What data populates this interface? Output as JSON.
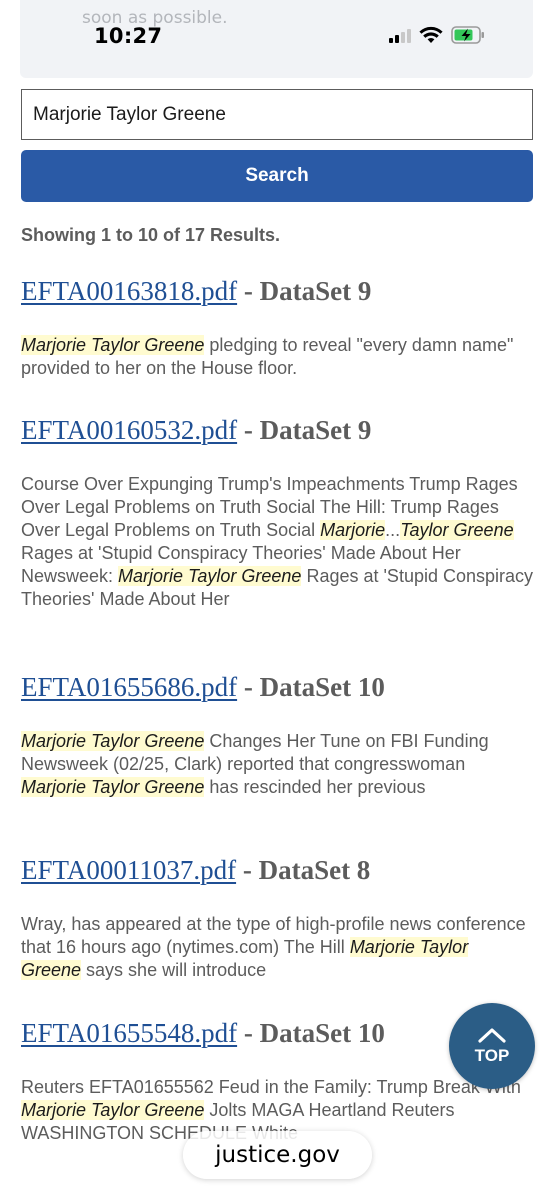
{
  "banner": {
    "text": "soon as possible."
  },
  "status_bar": {
    "time": "10:27",
    "icons": [
      "cellular-signal-icon",
      "wifi-icon",
      "battery-charging-icon"
    ]
  },
  "search": {
    "value": "Marjorie Taylor Greene",
    "button_label": "Search"
  },
  "results_summary": "Showing 1 to 10 of 17 Results.",
  "results": [
    {
      "file": "EFTA00163818.pdf",
      "separator": " - ",
      "dataset": "DataSet 9",
      "snippet": [
        {
          "hl": true,
          "t": "Marjorie Taylor Greene"
        },
        {
          "hl": false,
          "t": " pledging to reveal \"every damn name\" provided to her on the House floor."
        }
      ]
    },
    {
      "file": "EFTA00160532.pdf",
      "separator": " - ",
      "dataset": "DataSet 9",
      "snippet": [
        {
          "hl": false,
          "t": "Course Over Expunging Trump's Impeachments Trump Rages Over Legal Problems on Truth Social The Hill: Trump Rages Over Legal Problems on Truth Social "
        },
        {
          "hl": true,
          "t": "Marjorie"
        },
        {
          "hl": false,
          "t": "..."
        },
        {
          "hl": true,
          "t": "Taylor Greene"
        },
        {
          "hl": false,
          "t": " Rages at 'Stupid Conspiracy Theories' Made About Her Newsweek: "
        },
        {
          "hl": true,
          "t": "Marjorie Taylor Greene"
        },
        {
          "hl": false,
          "t": " Rages at 'Stupid Conspiracy Theories' Made About Her"
        }
      ]
    },
    {
      "file": "EFTA01655686.pdf",
      "separator": " - ",
      "dataset": "DataSet 10",
      "snippet": [
        {
          "hl": true,
          "t": "Marjorie Taylor Greene"
        },
        {
          "hl": false,
          "t": " Changes Her Tune on FBI Funding Newsweek (02/25, Clark) reported that congresswoman "
        },
        {
          "hl": true,
          "t": "Marjorie Taylor Greene"
        },
        {
          "hl": false,
          "t": " has rescinded her previous"
        }
      ]
    },
    {
      "file": "EFTA00011037.pdf",
      "separator": " - ",
      "dataset": "DataSet 8",
      "snippet": [
        {
          "hl": false,
          "t": "Wray, has appeared at the type of high-profile news conference that 16 hours ago (nytimes.com) The Hill "
        },
        {
          "hl": true,
          "t": "Marjorie Taylor Greene"
        },
        {
          "hl": false,
          "t": " says she will introduce"
        }
      ]
    },
    {
      "file": "EFTA01655548.pdf",
      "separator": " - ",
      "dataset": "DataSet 10",
      "snippet": [
        {
          "hl": false,
          "t": "Reuters EFTA01655562 Feud in the Family: Trump Break With "
        },
        {
          "hl": true,
          "t": "Marjorie Taylor Greene"
        },
        {
          "hl": false,
          "t": " Jolts MAGA Heartland Reuters WASHINGTON SCHEDULE White"
        }
      ]
    }
  ],
  "top_button": {
    "label": "TOP",
    "icon": "chevron-up-icon"
  },
  "url_bar": {
    "domain": "justice.gov"
  },
  "colors": {
    "primary_button": "#2a5aa6",
    "link": "#1f4f94",
    "highlight": "#fffbd0",
    "top_button": "#2b5d86",
    "muted_text": "#5c5c5c"
  }
}
